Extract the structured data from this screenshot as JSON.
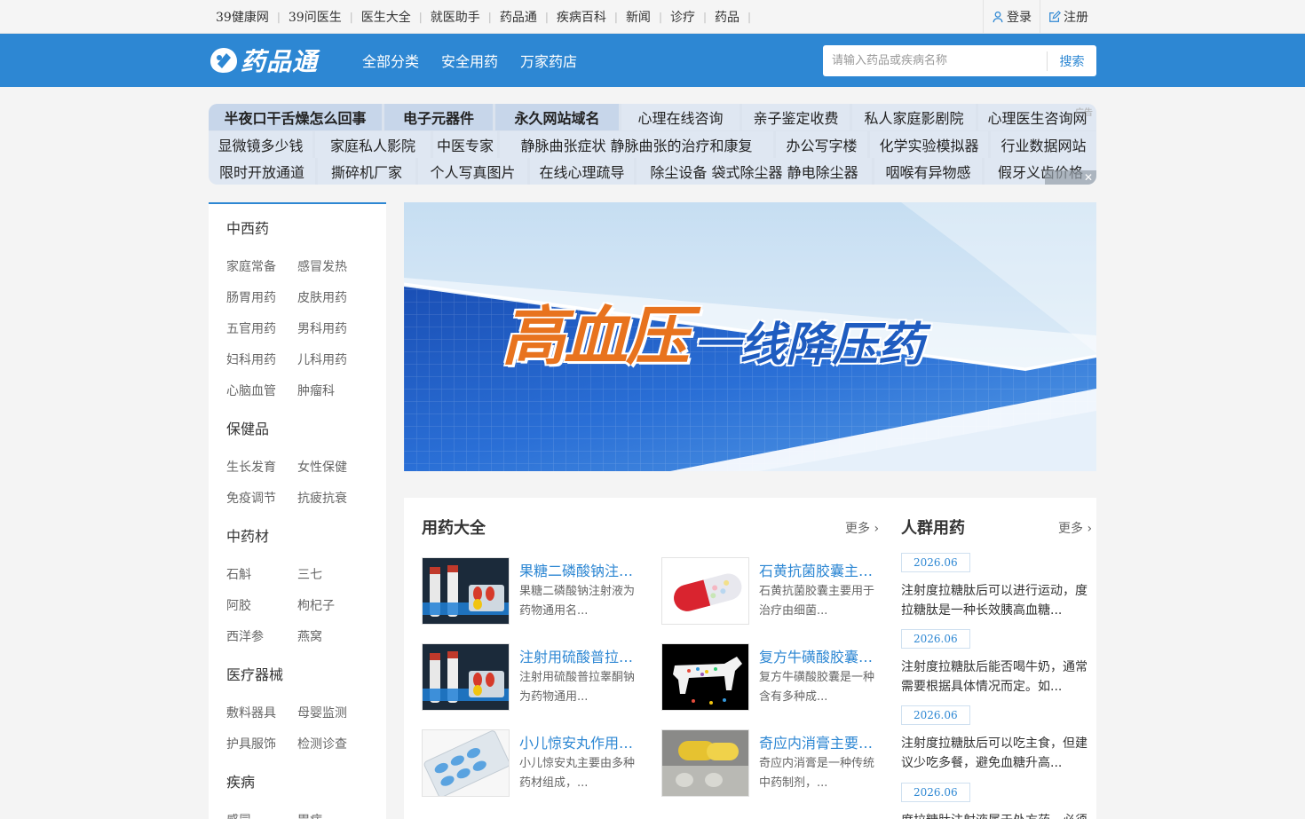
{
  "topnav": [
    "39健康网",
    "39问医生",
    "医生大全",
    "就医助手",
    "药品通",
    "疾病百科",
    "新闻",
    "诊疗",
    "药品"
  ],
  "auth": {
    "login": "登录",
    "register": "注册"
  },
  "header": {
    "logo_text": "药品通",
    "nav": [
      "全部分类",
      "安全用药",
      "万家药店"
    ],
    "search_placeholder": "请输入药品或疾病名称",
    "search_button": "搜索"
  },
  "adgrid": {
    "rows": [
      [
        "半夜口干舌燥怎么回事",
        "电子元器件",
        "永久网站域名",
        "心理在线咨询",
        "亲子鉴定收费",
        "私人家庭影剧院",
        "心理医生咨询网"
      ],
      [
        "显微镜多少钱",
        "家庭私人影院",
        "中医专家",
        "静脉曲张症状 静脉曲张的治疗和康复",
        "办公写字楼",
        "化学实验模拟器",
        "行业数据网站"
      ],
      [
        "限时开放通道",
        "撕碎机厂家",
        "个人写真图片",
        "在线心理疏导",
        "除尘设备 袋式除尘器 静电除尘器",
        "咽喉有异物感",
        "假牙义齿价格"
      ]
    ],
    "mark": "广告",
    "close": "✕"
  },
  "sidebar": [
    {
      "title": "中西药",
      "items": [
        "家庭常备",
        "感冒发热",
        "肠胃用药",
        "皮肤用药",
        "五官用药",
        "男科用药",
        "妇科用药",
        "儿科用药",
        "心脑血管",
        "肿瘤科"
      ]
    },
    {
      "title": "保健品",
      "items": [
        "生长发育",
        "女性保健",
        "免疫调节",
        "抗疲抗衰"
      ]
    },
    {
      "title": "中药材",
      "items": [
        "石斛",
        "三七",
        "阿胶",
        "枸杞子",
        "西洋参",
        "燕窝"
      ]
    },
    {
      "title": "医疗器械",
      "items": [
        "敷料器具",
        "母婴监测",
        "护具服饰",
        "检测诊查"
      ]
    },
    {
      "title": "疾病",
      "items": [
        "感冒",
        "胃病"
      ]
    }
  ],
  "banner": {
    "title_main": "高血压",
    "title_sub": "一线降压药"
  },
  "drugs": {
    "title": "用药大全",
    "more": "更多",
    "items": [
      {
        "name": "果糖二磷酸钠注射液",
        "desc": "果糖二磷酸钠注射液为药物通用名..."
      },
      {
        "name": "石黄抗菌胶囊主要用于",
        "desc": "石黄抗菌胶囊主要用于治疗由细菌..."
      },
      {
        "name": "注射用硫酸普拉睾酮钠",
        "desc": "注射用硫酸普拉睾酮钠为药物通用..."
      },
      {
        "name": "复方牛磺酸胶囊是一种",
        "desc": "复方牛磺酸胶囊是一种含有多种成..."
      },
      {
        "name": "小儿惊安丸作用与功效",
        "desc": "小儿惊安丸主要由多种药材组成，..."
      },
      {
        "name": "奇应内消膏主要作用",
        "desc": "奇应内消膏是一种传统中药制剂，..."
      }
    ]
  },
  "crowd": {
    "title": "人群用药",
    "more": "更多",
    "items": [
      {
        "date": "2026.06",
        "text": "注射度拉糖肽后可以进行运动，度拉糖肽是一种长效胰高血糖..."
      },
      {
        "date": "2026.06",
        "text": "注射度拉糖肽后能否喝牛奶，通常需要根据具体情况而定。如..."
      },
      {
        "date": "2026.06",
        "text": "注射度拉糖肽后可以吃主食，但建议少吃多餐，避免血糖升高..."
      },
      {
        "date": "2026.06",
        "text": "度拉糖肽注射液属于处方药，必须"
      }
    ]
  },
  "colors": {
    "brand_blue": "#2d87d3",
    "banner_orange": "#e8731e"
  }
}
